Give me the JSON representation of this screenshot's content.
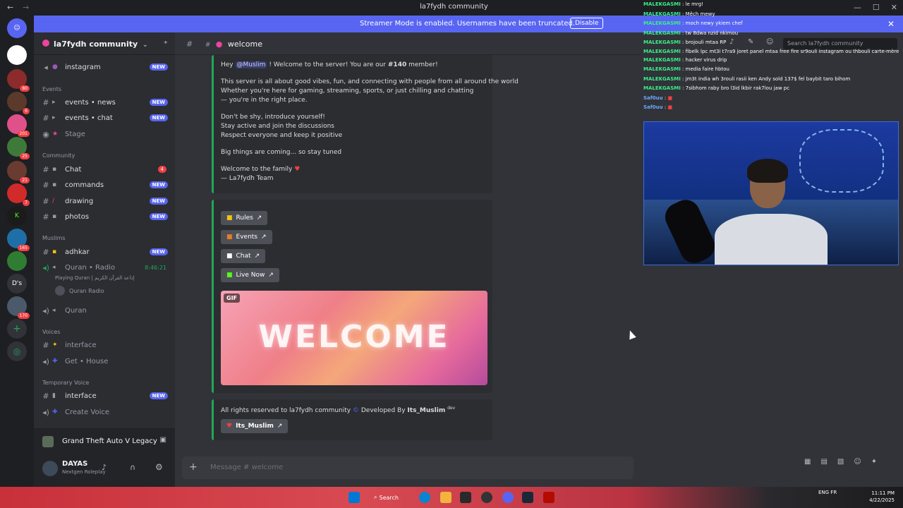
{
  "window": {
    "title": "la7fydh community"
  },
  "banner": {
    "text": "Streamer Mode is enabled. Usernames have been truncated.",
    "button": "Disable"
  },
  "servers": [
    {
      "label": "",
      "badge": ""
    },
    {
      "label": "",
      "badge": "6"
    },
    {
      "label": "",
      "badge": "80"
    },
    {
      "label": "",
      "badge": "6"
    },
    {
      "label": "",
      "badge": "201"
    },
    {
      "label": "",
      "badge": "25"
    },
    {
      "label": "",
      "badge": "21"
    },
    {
      "label": "",
      "badge": "7"
    },
    {
      "label": "",
      "badge": ""
    },
    {
      "label": "",
      "badge": "165"
    },
    {
      "label": "",
      "badge": ""
    },
    {
      "label": "D's",
      "badge": ""
    },
    {
      "label": "",
      "badge": "170"
    }
  ],
  "sidebar": {
    "server_name": "la7fydh community",
    "categories": {
      "events": "Events",
      "community": "Community",
      "muslims": "Muslims",
      "voices": "Voices",
      "temporary": "Temporary Voice"
    },
    "channels": {
      "instagram": {
        "label": "instagram",
        "badge": "NEW"
      },
      "events_news": {
        "label": "events • news",
        "badge": "NEW"
      },
      "events_chat": {
        "label": "events • chat",
        "badge": "NEW"
      },
      "stage": {
        "label": "Stage"
      },
      "chat": {
        "label": "Chat",
        "count": "4"
      },
      "commands": {
        "label": "commands",
        "badge": "NEW"
      },
      "drawing": {
        "label": "drawing",
        "badge": "NEW"
      },
      "photos": {
        "label": "photos",
        "badge": "NEW"
      },
      "adhkar": {
        "label": "adhkar",
        "badge": "NEW"
      },
      "quran_radio": {
        "label": "Quran • Radio",
        "time": "8:46:21",
        "activity": "Playing Quran | إذاعة القرآن الكريم",
        "member": "Quran Radio"
      },
      "quran": {
        "label": "Quran"
      },
      "interface_voice": {
        "label": "interface"
      },
      "get_house": {
        "label": "Get • House"
      },
      "interface_temp": {
        "label": "interface",
        "badge": "NEW"
      },
      "create_voice": {
        "label": "Create Voice"
      }
    },
    "activity": "Grand Theft Auto V Legacy",
    "user": {
      "name": "DAYAS",
      "status": "Nextgen Roleplay"
    }
  },
  "channel": {
    "name": "welcome",
    "prefix": "#"
  },
  "message": {
    "greeting_pre": "Hey",
    "mention": "@Muslim",
    "greeting_post": "! Welcome to the server! You are our",
    "member_number": "#140",
    "greeting_tail": "member!",
    "about_1": "This server is all about good vibes, fun, and connecting with people from all around the world",
    "about_2": "Whether you're here for gaming, streaming, sports, or just chilling and chatting",
    "about_3": "— you're in the right place.",
    "tip_1": "Don't be shy, introduce yourself!",
    "tip_2": "Stay active and join the discussions",
    "tip_3": "Respect everyone and keep it positive",
    "coming": "Big things are coming... so stay tuned",
    "family": "Welcome to the family",
    "signoff": "— La7fydh Team"
  },
  "links": {
    "rules": "Rules",
    "events": "Events",
    "chat": "Chat",
    "live": "Live Now"
  },
  "gif": {
    "tag": "GIF",
    "word": "WELCOME"
  },
  "footer": {
    "rights": "All rights reserved to la7fydh community",
    "dev_pre": "Developed By",
    "dev_name": "Its_Muslim",
    "dev_tag": "dev",
    "button": "Its_Muslim"
  },
  "composer": {
    "placeholder": "Message # welcome"
  },
  "search": {
    "placeholder": "Search la7fydh community"
  },
  "stream_chat": [
    {
      "user": "MALEKGASMI",
      "text": "le mrg!"
    },
    {
      "user": "MALEKGASMI",
      "text": "Mêch mewy"
    },
    {
      "user": "MALEKGASMI",
      "text": "moch newy ykiem chef"
    },
    {
      "user": "MALEKGASMI",
      "text": "tw 8dwa nzid nkimou"
    },
    {
      "user": "MALEKGASMI",
      "text": "brojouli mtaa RP"
    },
    {
      "user": "MALEKGASMI",
      "text": "fibelk lpc mt3i t7ra9 joret panel mtaa free fire sr9ouli instagram ou thbouli carte-mère"
    },
    {
      "user": "MALEKGASMI",
      "text": "hacker virus drip"
    },
    {
      "user": "MALEKGASMI",
      "text": "media faire hbtou"
    },
    {
      "user": "MALEKGASMI",
      "text": "jm3t india wh 3rouli rasii ken Andy sold 137$ fel baybit taro bihom"
    },
    {
      "user": "MALEKGASMI",
      "text": "7sibhom raby bro l3id lkbir rak7lou jaw pc"
    },
    {
      "user": "Saf0uu",
      "text": ""
    },
    {
      "user": "Saf0uu",
      "text": ""
    }
  ],
  "taskbar": {
    "search": "Search",
    "lang": "ENG FR",
    "time": "11:11 PM",
    "date": "4/22/2025"
  },
  "colors": {
    "accent": "#5865f2",
    "green": "#23a559",
    "red": "#f23f43"
  }
}
